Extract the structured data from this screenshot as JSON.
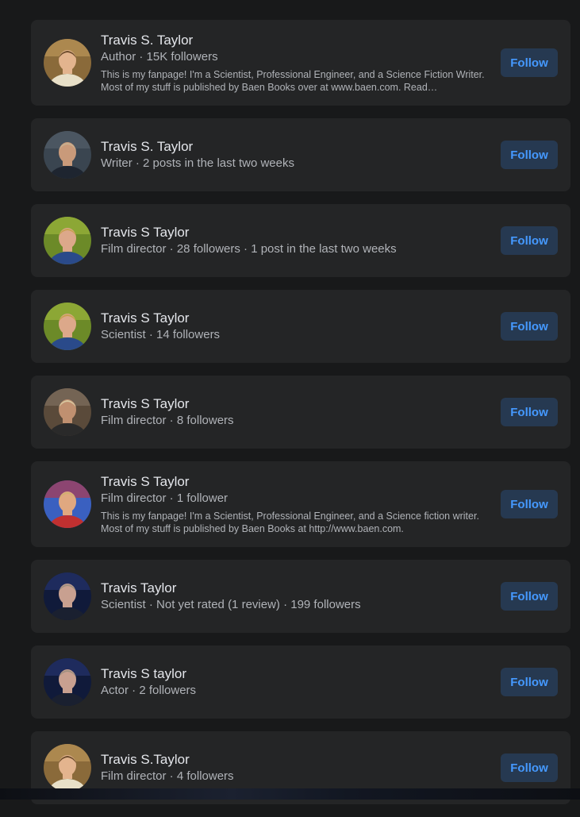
{
  "results": [
    {
      "name": "Travis S. Taylor",
      "meta": "Author · 15K followers",
      "description": "This is my fanpage! I'm a Scientist, Professional Engineer, and a Science Fiction Writer. Most of my stuff is published by Baen Books over at www.baen.com. Read…",
      "follow": "Follow",
      "avatar_style": "bookshelf"
    },
    {
      "name": "Travis S. Taylor",
      "meta": "Writer · 2 posts in the last two weeks",
      "follow": "Follow",
      "avatar_style": "dark"
    },
    {
      "name": "Travis S Taylor",
      "meta": "Film director · 28 followers · 1 post in the last two weeks",
      "follow": "Follow",
      "avatar_style": "green"
    },
    {
      "name": "Travis S Taylor",
      "meta": "Scientist · 14 followers",
      "follow": "Follow",
      "avatar_style": "green"
    },
    {
      "name": "Travis S Taylor",
      "meta": "Film director · 8 followers",
      "follow": "Follow",
      "avatar_style": "studio"
    },
    {
      "name": "Travis S Taylor",
      "meta": "Film director · 1 follower",
      "description": "This is my fanpage! I'm a Scientist, Professional Engineer, and a Science fiction writer. Most of my stuff is published by Baen Books at http://www.baen.com.",
      "follow": "Follow",
      "avatar_style": "colorful"
    },
    {
      "name": "Travis Taylor",
      "meta": "Scientist · Not yet rated (1 review) · 199 followers",
      "follow": "Follow",
      "avatar_style": "poster"
    },
    {
      "name": "Travis S taylor",
      "meta": "Actor · 2 followers",
      "follow": "Follow",
      "avatar_style": "poster"
    },
    {
      "name": "Travis S.Taylor",
      "meta": "Film director · 4 followers",
      "follow": "Follow",
      "avatar_style": "bookshelf"
    }
  ]
}
